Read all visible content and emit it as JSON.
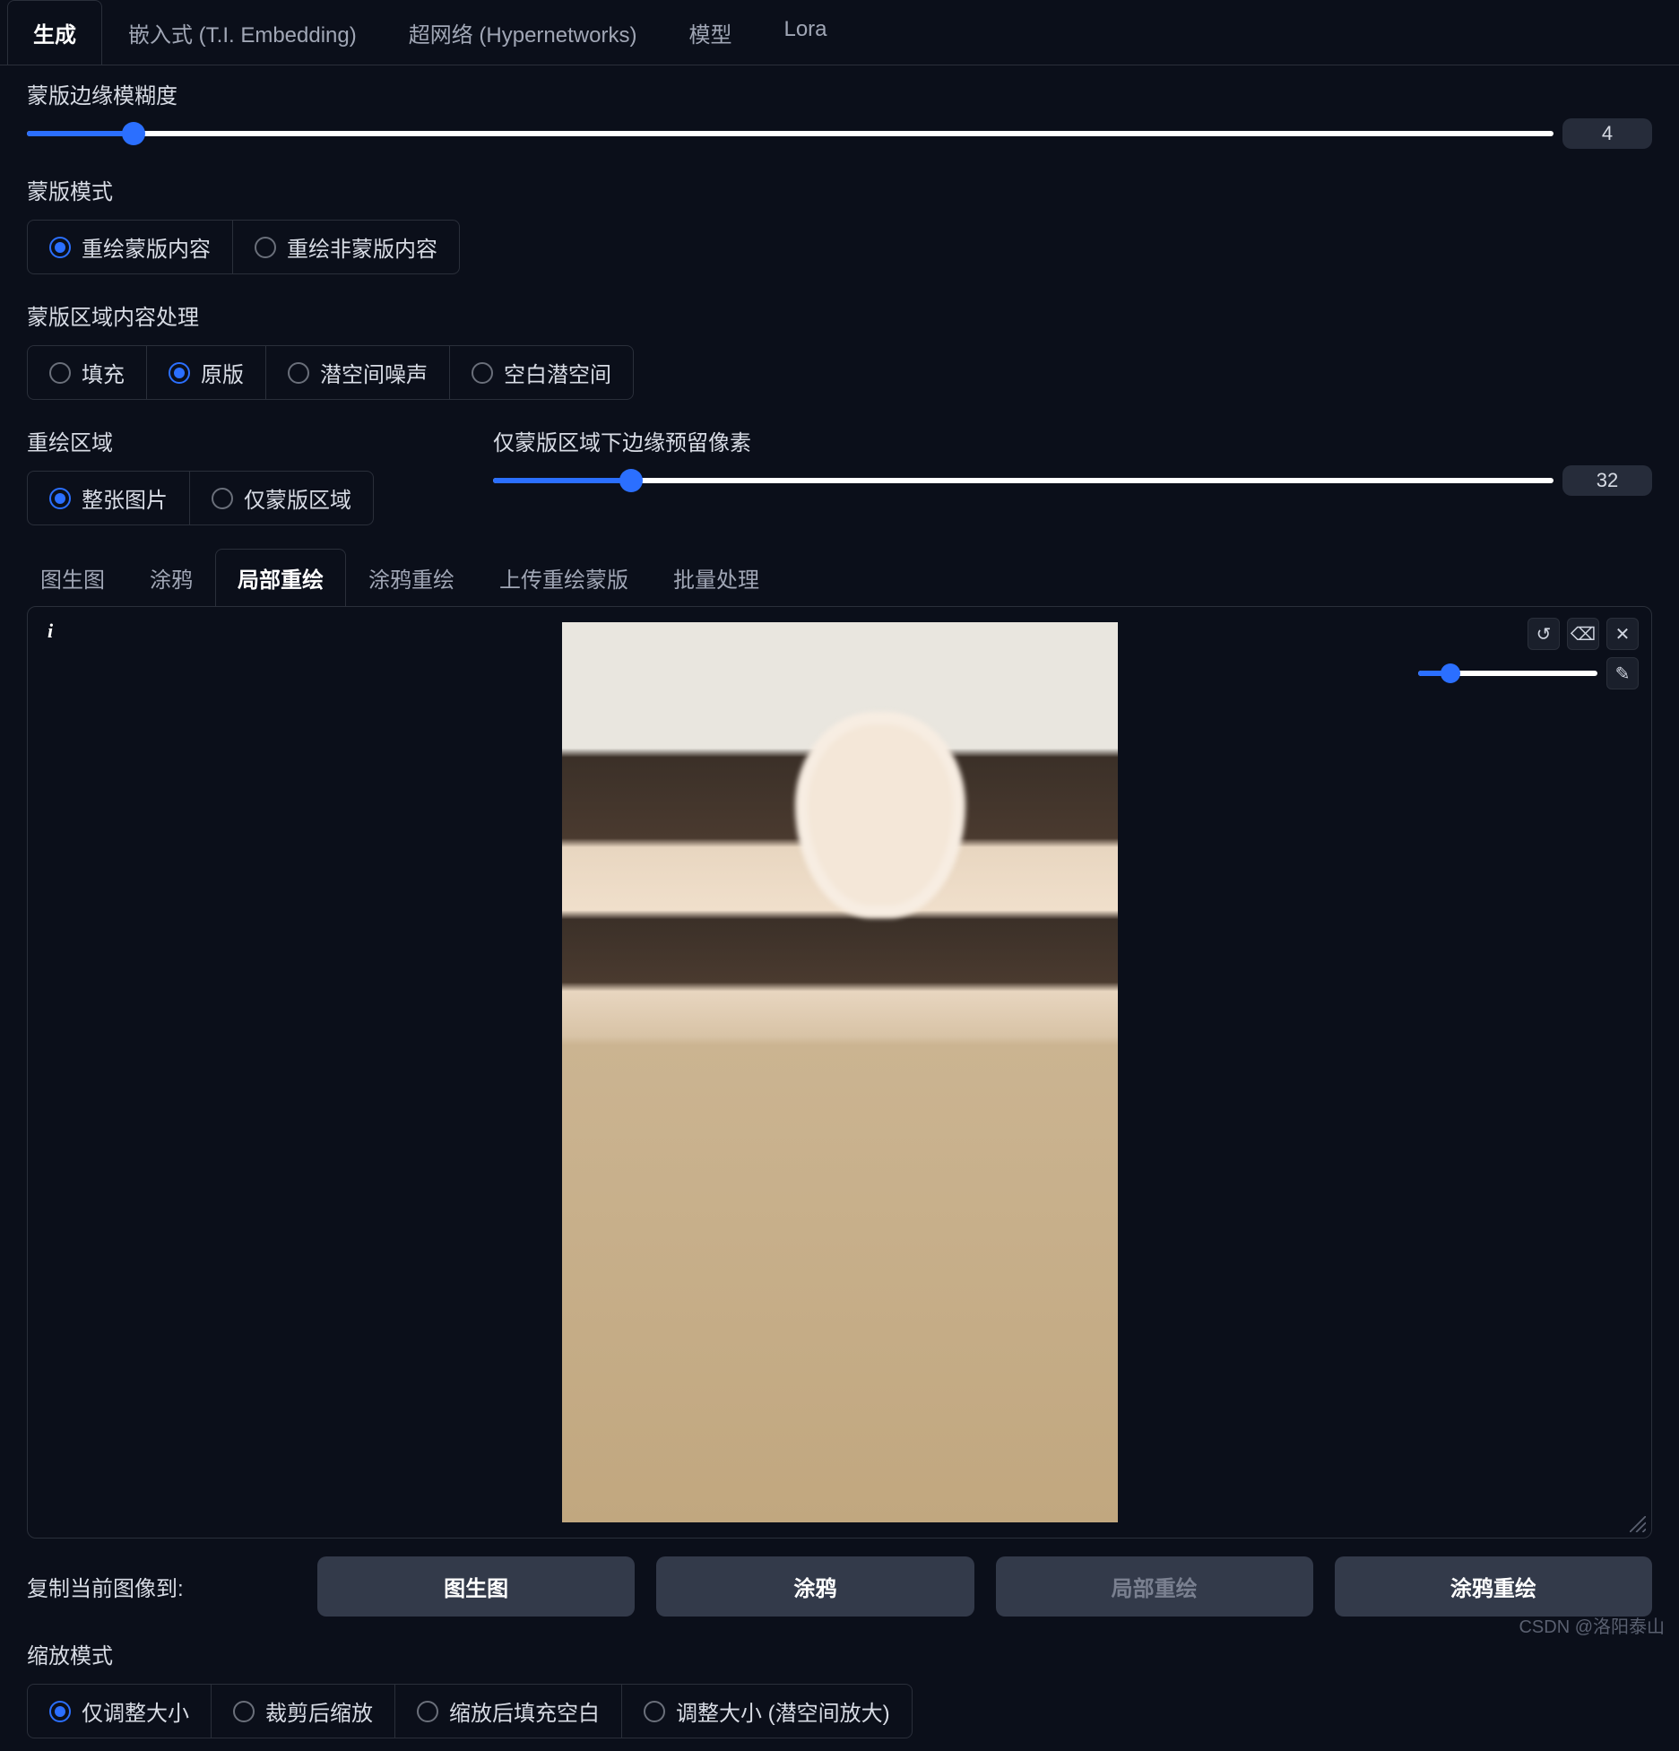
{
  "top_tabs": {
    "generate": "生成",
    "embedding": "嵌入式 (T.I. Embedding)",
    "hypernet": "超网络 (Hypernetworks)",
    "model": "模型",
    "lora": "Lora"
  },
  "mask_blur": {
    "label": "蒙版边缘模糊度",
    "value": "4",
    "min": 0,
    "max": 64,
    "pct": 7
  },
  "mask_mode": {
    "label": "蒙版模式",
    "opt1": "重绘蒙版内容",
    "opt2": "重绘非蒙版内容"
  },
  "mask_content": {
    "label": "蒙版区域内容处理",
    "fill": "填充",
    "original": "原版",
    "latent_noise": "潜空间噪声",
    "latent_nothing": "空白潜空间"
  },
  "inpaint_area": {
    "label": "重绘区域",
    "whole": "整张图片",
    "only": "仅蒙版区域"
  },
  "padding": {
    "label": "仅蒙版区域下边缘预留像素",
    "value": "32",
    "min": 0,
    "max": 256,
    "pct": 13
  },
  "sub_tabs": {
    "img2img": "图生图",
    "sketch": "涂鸦",
    "inpaint": "局部重绘",
    "inpaint_sketch": "涂鸦重绘",
    "upload_mask": "上传重绘蒙版",
    "batch": "批量处理"
  },
  "canvas": {
    "icons": {
      "undo": "↺",
      "erase": "⌫",
      "close": "✕",
      "brush": "✎"
    },
    "brush_pct": 18
  },
  "copy": {
    "label": "复制当前图像到:",
    "img2img": "图生图",
    "sketch": "涂鸦",
    "inpaint": "局部重绘",
    "inpaint_sketch": "涂鸦重绘"
  },
  "resize_mode": {
    "label": "缩放模式",
    "just": "仅调整大小",
    "crop": "裁剪后缩放",
    "fill": "缩放后填充空白",
    "latent": "调整大小 (潜空间放大)"
  },
  "watermark": "CSDN @洛阳泰山"
}
